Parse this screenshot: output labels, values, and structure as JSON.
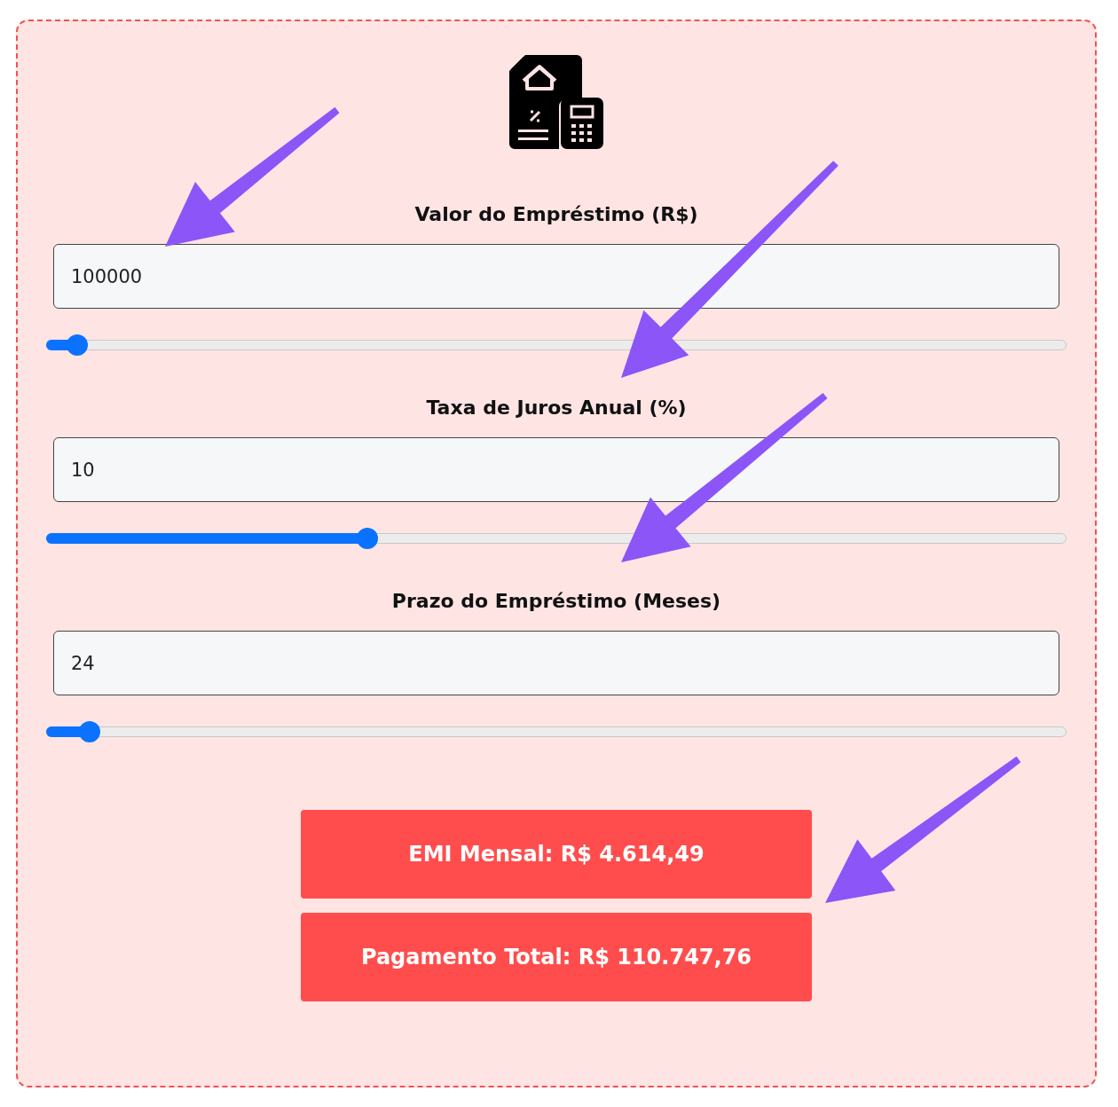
{
  "fields": [
    {
      "label": "Valor do Empréstimo (R$)",
      "value": "100000",
      "level": 0.03
    },
    {
      "label": "Taxa de Juros Anual (%)",
      "value": "10",
      "level": 0.315
    },
    {
      "label": "Prazo do Empréstimo (Meses)",
      "value": "24",
      "level": 0.043
    }
  ],
  "results": [
    "EMI Mensal: R$ 4.614,49",
    "Pagamento Total: R$ 110.747,76"
  ]
}
